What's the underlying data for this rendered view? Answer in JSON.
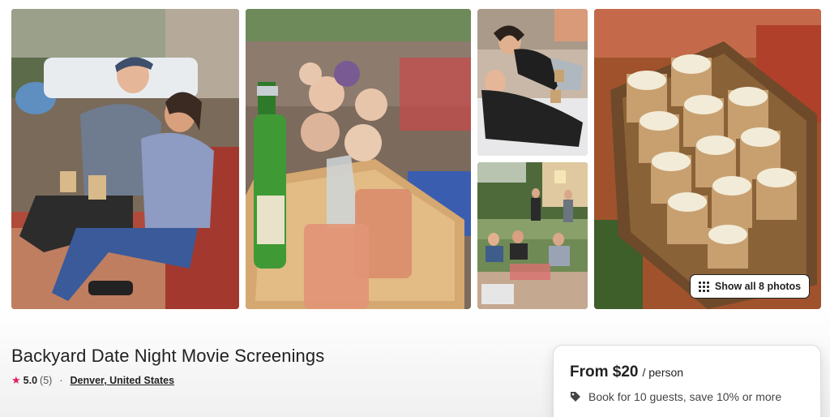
{
  "listing": {
    "title": "Backyard Date Night Movie Screenings",
    "rating": "5.0",
    "review_count": "(5)",
    "separator": "·",
    "location": "Denver, United States"
  },
  "gallery": {
    "show_all_label": "Show all 8 photos",
    "photos": [
      {
        "name": "couple-eating-popcorn-photo",
        "accent": "#8da0b5"
      },
      {
        "name": "drinks-and-roses-tray-photo",
        "accent": "#c38c4e"
      },
      {
        "name": "couple-lounging-photo",
        "accent": "#d9cfc5"
      },
      {
        "name": "backyard-guests-photo",
        "accent": "#6d8a4f"
      },
      {
        "name": "popcorn-basket-photo",
        "accent": "#b98a5a"
      }
    ]
  },
  "price_card": {
    "price": "From $20",
    "unit": "/ person",
    "discount": "Book for 10 guests, save 10% or more"
  },
  "colors": {
    "star": "#e31c5f",
    "text": "#222222",
    "muted": "#555555"
  },
  "icons": [
    "star-icon",
    "grid-icon",
    "tag-icon"
  ]
}
